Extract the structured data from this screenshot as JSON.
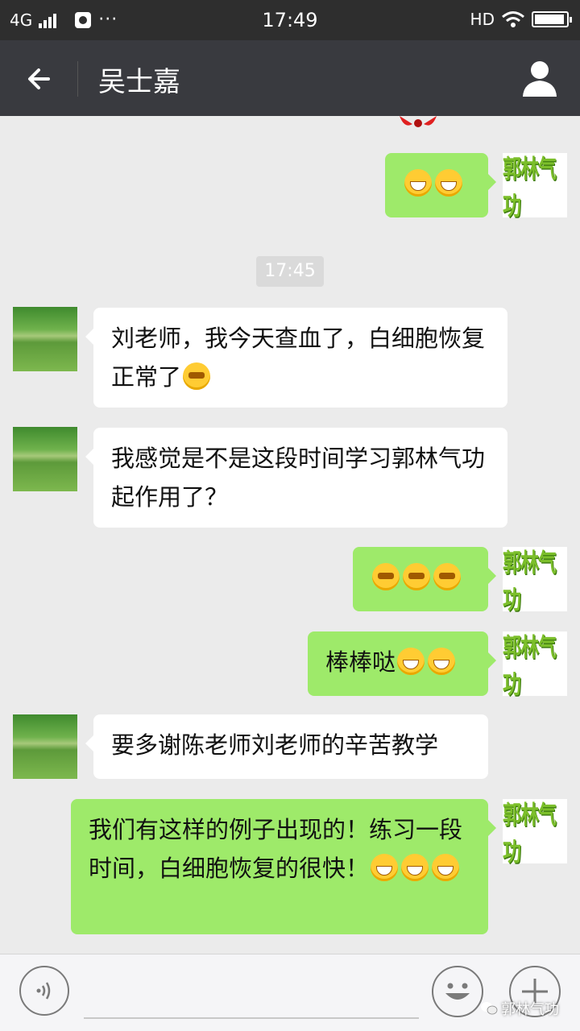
{
  "status_bar": {
    "network": "4G",
    "time": "17:49",
    "hd": "HD",
    "battery_level": 0.95
  },
  "header": {
    "title": "吴士嘉"
  },
  "colors": {
    "outgoing_bubble": "#9eea6a",
    "incoming_bubble": "#ffffff",
    "title_bar": "#393a3f"
  },
  "sender_avatar_text": "郭林气功",
  "timestamp": "17:45",
  "messages": [
    {
      "side": "out",
      "text": "",
      "emojis": [
        "grin",
        "grin"
      ]
    },
    {
      "side": "in",
      "text": "刘老师，我今天查血了，白细胞恢复正常了",
      "emojis": [
        "hug"
      ]
    },
    {
      "side": "in",
      "text": "我感觉是不是这段时间学习郭林气功起作用了？",
      "emojis": []
    },
    {
      "side": "out",
      "text": "",
      "emojis": [
        "hug",
        "hug",
        "hug"
      ]
    },
    {
      "side": "out",
      "text": "棒棒哒",
      "emojis": [
        "grin",
        "grin"
      ]
    },
    {
      "side": "in",
      "text": "要多谢陈老师刘老师的辛苦教学",
      "emojis": []
    },
    {
      "side": "out",
      "text": "我们有这样的例子出现的！练习一段时间，白细胞恢复的很快！",
      "emojis": [
        "grin",
        "grin",
        "grin"
      ]
    }
  ],
  "watermark": "郭林气功"
}
